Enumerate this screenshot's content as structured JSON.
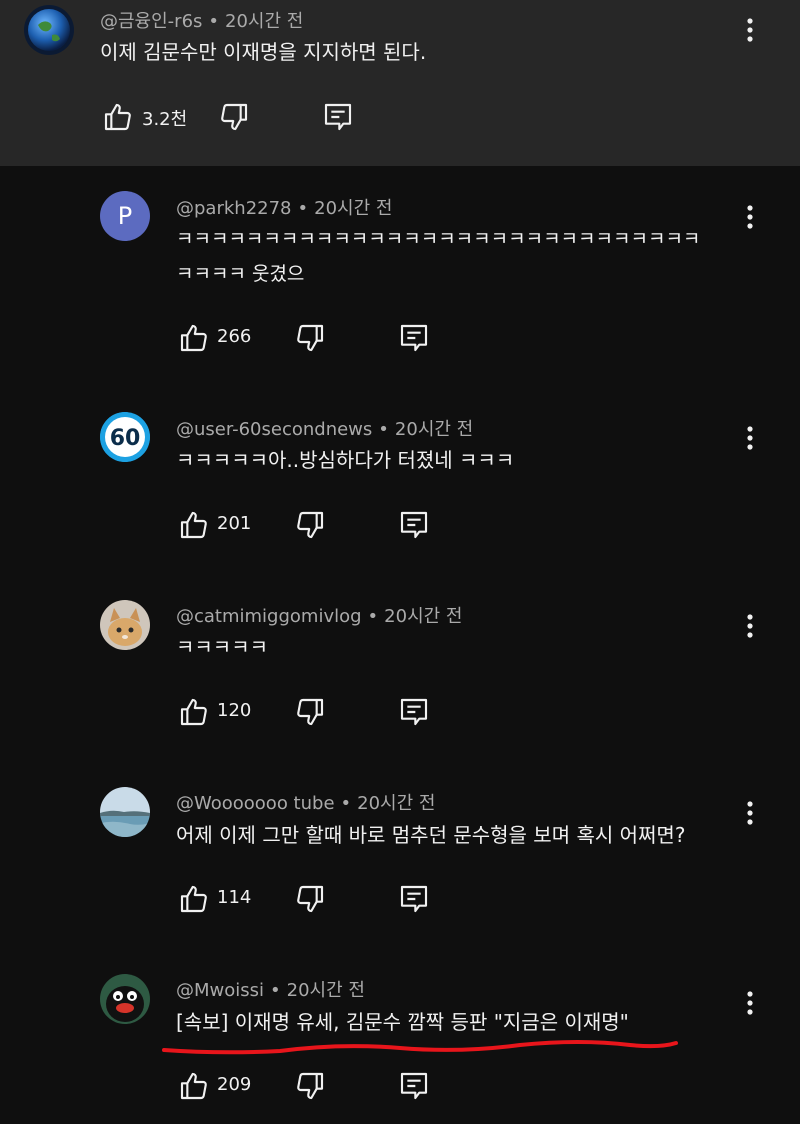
{
  "comments": [
    {
      "handle": "@금융인-r6s",
      "time": "20시간 전",
      "lines": [
        "이제 김문수만 이재명을 지지하면 된다."
      ],
      "likes": "3.2천"
    },
    {
      "handle": "@parkh2278",
      "time": "20시간 전",
      "lines": [
        "ㅋㅋㅋㅋㅋㅋㅋㅋㅋㅋㅋㅋㅋㅋㅋㅋㅋㅋㅋㅋㅋㅋㅋㅋㅋㅋㅋㅋㅋㅋ",
        "ㅋㅋㅋㅋ 웃겼으"
      ],
      "likes": "266",
      "avatar_letter": "P"
    },
    {
      "handle": "@user-60secondnews",
      "time": "20시간 전",
      "lines": [
        "ㅋㅋㅋㅋㅋ아..방심하다가 터졌네 ㅋㅋㅋ"
      ],
      "likes": "201",
      "avatar_text": "60"
    },
    {
      "handle": "@catmimiggomivlog",
      "time": "20시간 전",
      "lines": [
        "ㅋㅋㅋㅋㅋ"
      ],
      "likes": "120"
    },
    {
      "handle": "@Wooooooo tube",
      "time": "20시간 전",
      "lines": [
        "어제 이제 그만 할때 바로 멈추던 문수형을 보며 혹시 어쩌면?"
      ],
      "likes": "114"
    },
    {
      "handle": "@Mwoissi",
      "time": "20시간 전",
      "lines": [
        "[속보] 이재명 유세, 김문수 깜짝 등판 \"지금은 이재명\""
      ],
      "likes": "209"
    }
  ],
  "colors": {
    "background": "#0f0f0f",
    "highlight": "#272727",
    "meta": "#aaaaaa",
    "text": "#f1f1f1",
    "annotation": "#e8151b",
    "avatar_p": "#5c6bc0",
    "avatar_60": "#1da1e2"
  },
  "icons": {
    "like": "thumbs-up-icon",
    "dislike": "thumbs-down-icon",
    "reply": "reply-icon",
    "more": "more-vert-icon"
  }
}
